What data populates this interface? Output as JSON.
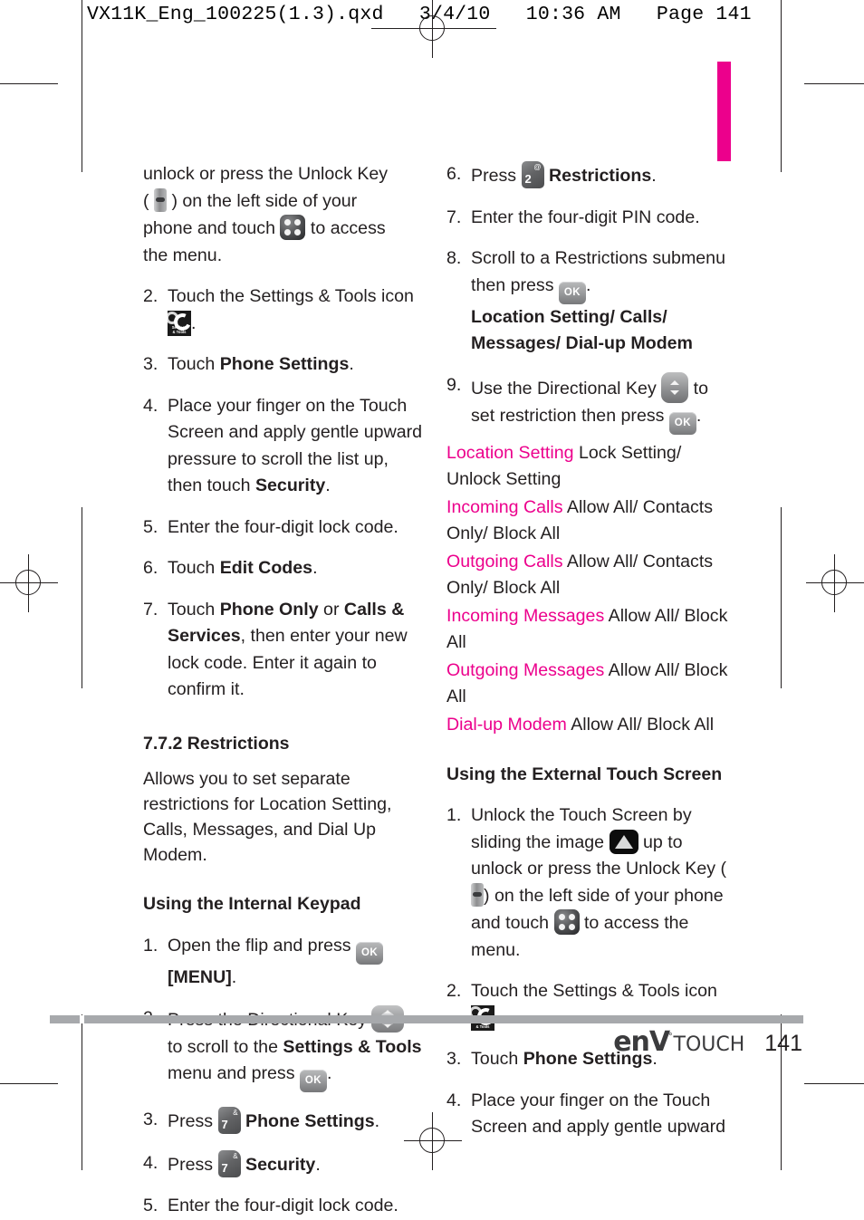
{
  "prepress": {
    "file_info": "VX11K_Eng_100225(1.3).qxd   3/4/10   10:36 AM   Page 141",
    "accent_color": "#ec008c"
  },
  "left_column": {
    "step1_continuation": {
      "line1_a": "unlock or press the Unlock Key",
      "line2_a": "(",
      "line2_b": ") on the left side of your",
      "line3_a": "phone and touch",
      "line3_b": "to access",
      "line4": "the menu."
    },
    "steps": [
      {
        "num": "2.",
        "text_a": "Touch the Settings & Tools icon",
        "text_b": "."
      },
      {
        "num": "3.",
        "text_a": "Touch ",
        "bold": "Phone Settings",
        "text_b": "."
      },
      {
        "num": "4.",
        "text_a": "Place your finger on the Touch Screen and apply gentle upward pressure to scroll the list up, then touch ",
        "bold": "Security",
        "text_b": "."
      },
      {
        "num": "5.",
        "text_a": "Enter the four-digit lock code."
      },
      {
        "num": "6.",
        "text_a": "Touch ",
        "bold": "Edit Codes",
        "text_b": "."
      },
      {
        "num": "7.",
        "text_a": "Touch ",
        "bold": "Phone Only",
        "text_mid": " or ",
        "bold2": "Calls & Services",
        "text_b": ", then enter your new lock code. Enter it again to confirm it."
      }
    ],
    "section_heading": "7.7.2 Restrictions",
    "section_blurb": "Allows you to set separate restrictions for Location Setting, Calls, Messages, and Dial Up Modem.",
    "subheading": "Using the Internal Keypad",
    "keypad_steps": [
      {
        "num": "1.",
        "text_a": "Open the flip and press",
        "icon": "ok-key",
        "bold": "[MENU]",
        "text_b": "."
      },
      {
        "num": "2.",
        "text_a": "Press the Directional Key",
        "icon": "directional-key",
        "text_b": "to scroll to the ",
        "bold": "Settings & Tools",
        "text_c": " menu and press",
        "icon2": "ok-key",
        "text_d": "."
      },
      {
        "num": "3.",
        "text_a": "Press",
        "key_digit": "7",
        "key_symbol": "&",
        "bold": "Phone Settings",
        "text_b": "."
      },
      {
        "num": "4.",
        "text_a": "Press",
        "key_digit": "7",
        "key_symbol": "&",
        "bold": "Security",
        "text_b": "."
      },
      {
        "num": "5.",
        "text_a": "Enter the four-digit lock code."
      }
    ]
  },
  "right_column": {
    "steps": [
      {
        "num": "6.",
        "text_a": "Press",
        "key_digit": "2",
        "key_symbol": "@",
        "bold": "Restrictions",
        "text_b": "."
      },
      {
        "num": "7.",
        "text_a": "Enter the four-digit PIN code."
      },
      {
        "num": "8.",
        "text_a": "Scroll to a Restrictions submenu then press",
        "icon": "ok-key",
        "text_b": ".",
        "bold_line1": "Location Setting/ Calls/",
        "bold_line2": "Messages/ Dial-up Modem"
      },
      {
        "num": "9.",
        "text_a": "Use the Directional Key",
        "icon": "directional-key-vertical",
        "text_b": "to set restriction then press",
        "icon2": "ok-key",
        "text_c": "."
      }
    ],
    "restrictions": [
      {
        "label": "Location Setting",
        "values": "Lock Setting/ Unlock Setting"
      },
      {
        "label": "Incoming Calls",
        "values": "Allow All/ Contacts Only/ Block All"
      },
      {
        "label": "Outgoing Calls",
        "values": "Allow All/ Contacts Only/ Block All"
      },
      {
        "label": "Incoming Messages",
        "values": "Allow All/ Block All"
      },
      {
        "label": "Outgoing Messages",
        "values": "Allow All/ Block All"
      },
      {
        "label": "Dial-up Modem",
        "values": "Allow All/ Block All"
      }
    ],
    "subheading": "Using the External Touch Screen",
    "touch_steps": [
      {
        "num": "1.",
        "text_a": "Unlock the Touch Screen by sliding the image",
        "icon": "slide-up-unlock",
        "text_b": "up to unlock or press the Unlock Key (",
        "icon2": "unlock-key",
        "text_c": ") on the left side of your phone and touch",
        "icon3": "menu-dots",
        "text_d": "to access the menu."
      },
      {
        "num": "2.",
        "text_a": "Touch the Settings & Tools icon",
        "icon": "settings-tools",
        "text_b": "."
      },
      {
        "num": "3.",
        "text_a": "Touch ",
        "bold": "Phone Settings",
        "text_b": "."
      },
      {
        "num": "4.",
        "text_a": "Place your finger on the Touch Screen and apply gentle upward"
      }
    ]
  },
  "footer": {
    "brand_env": "enV",
    "brand_tm": "°",
    "brand_touch": "TOUCH",
    "page_number": "141"
  },
  "icon_labels": {
    "settings_tools_line1": "Settings",
    "settings_tools_line2": "& Tools",
    "ok": "OK"
  }
}
